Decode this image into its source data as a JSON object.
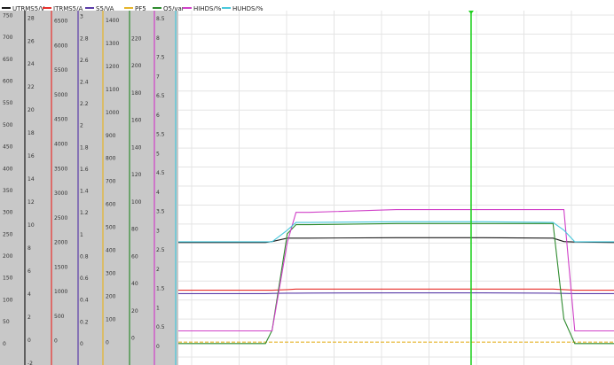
{
  "legend": [
    {
      "name": "UTRMS5/V",
      "color": "#1a1a1a"
    },
    {
      "name": "ITRMS5/A",
      "color": "#e8302c"
    },
    {
      "name": "S5/VA",
      "color": "#5a3ba8"
    },
    {
      "name": "PF5",
      "color": "#e5b42a"
    },
    {
      "name": "Q5/var",
      "color": "#2e8b2e"
    },
    {
      "name": "HIHDS/%",
      "color": "#d040c8"
    },
    {
      "name": "HUHDS/%",
      "color": "#48c8dc"
    }
  ],
  "axis_tick_labels": [
    [
      "750",
      "700",
      "650",
      "600",
      "550",
      "500",
      "450",
      "400",
      "350",
      "300",
      "250",
      "200",
      "150",
      "100",
      "50",
      "0",
      "-50"
    ],
    [
      "28",
      "26",
      "24",
      "22",
      "20",
      "18",
      "16",
      "14",
      "12",
      "10",
      "8",
      "6",
      "4",
      "2",
      "0",
      "-2"
    ],
    [
      "6500",
      "6000",
      "5500",
      "5000",
      "4500",
      "4000",
      "3500",
      "3000",
      "2500",
      "2000",
      "1500",
      "1000",
      "500",
      "0",
      "-500"
    ],
    [
      "3",
      "2.8",
      "2.6",
      "2.4",
      "2.2",
      "2",
      "1.8",
      "1.6",
      "1.4",
      "1.2",
      "1",
      "0.8",
      "0.6",
      "0.4",
      "0.2",
      "0",
      "-0.2"
    ],
    [
      "1400",
      "1300",
      "1200",
      "1100",
      "1000",
      "900",
      "800",
      "700",
      "600",
      "500",
      "400",
      "300",
      "200",
      "100",
      "0",
      "-100"
    ],
    [
      "240",
      "220",
      "200",
      "180",
      "160",
      "140",
      "120",
      "100",
      "80",
      "60",
      "40",
      "20",
      "0",
      "-20"
    ],
    [
      "8.5",
      "8",
      "7.5",
      "7",
      "6.5",
      "6",
      "5.5",
      "5",
      "4.5",
      "4",
      "3.5",
      "3",
      "2.5",
      "2",
      "1.5",
      "1",
      "0.5",
      "0",
      "-0.5"
    ]
  ],
  "chart_data": {
    "type": "line",
    "title": "",
    "grid": true,
    "cursor_x": 0.672,
    "x": [
      0,
      0.2,
      0.215,
      0.25,
      0.27,
      0.3,
      0.5,
      0.7,
      0.86,
      0.885,
      0.91,
      1.0
    ],
    "y_axes": [
      {
        "name": "UTRMS5/V",
        "range": [
          -50,
          760
        ]
      },
      {
        "name": "ITRMS5/A",
        "range": [
          -2.2,
          28.6
        ]
      },
      {
        "name": "S5/VA",
        "range": [
          -500,
          6700
        ]
      },
      {
        "name": "PF5",
        "range": [
          -0.2,
          3.05
        ]
      },
      {
        "name": "Q5/var",
        "range": [
          -100,
          1440
        ]
      },
      {
        "name": "HIHDS/%",
        "range": [
          -20,
          240
        ]
      },
      {
        "name": "HUHDS/%",
        "range": [
          -0.5,
          8.7
        ]
      }
    ],
    "series": [
      {
        "name": "UTRMS5/V",
        "color": "#1a1a1a",
        "values": [
          230,
          230,
          232,
          240,
          240,
          240,
          241,
          241,
          240,
          232,
          231,
          230
        ]
      },
      {
        "name": "ITRMS5/A",
        "color": "#e8302c",
        "values": [
          4.3,
          4.3,
          4.3,
          4.35,
          4.4,
          4.4,
          4.4,
          4.4,
          4.4,
          4.35,
          4.3,
          4.3
        ]
      },
      {
        "name": "S5/VA",
        "color": "#5a3ba8",
        "values": [
          950,
          950,
          955,
          960,
          960,
          962,
          965,
          965,
          960,
          955,
          950,
          950
        ]
      },
      {
        "name": "PF5",
        "color": "#e5b42a",
        "values": [
          0.01,
          0.01,
          0.01,
          0.01,
          0.01,
          0.01,
          0.01,
          0.01,
          0.01,
          0.01,
          0.01,
          0.01
        ]
      },
      {
        "name": "Q5/var",
        "color": "#2e8b2e",
        "values": [
          -7,
          -7,
          50,
          470,
          510,
          510,
          515,
          515,
          515,
          100,
          -7,
          -7
        ]
      },
      {
        "name": "HIHDS/%",
        "color": "#d040c8",
        "values": [
          5,
          5,
          5,
          70,
          92,
          92,
          94,
          94,
          94,
          94,
          5,
          5
        ]
      },
      {
        "name": "HUHDS/%",
        "color": "#48c8dc",
        "values": [
          2.7,
          2.7,
          2.7,
          3.0,
          3.2,
          3.2,
          3.22,
          3.22,
          3.2,
          3.0,
          2.7,
          2.7
        ]
      }
    ]
  }
}
